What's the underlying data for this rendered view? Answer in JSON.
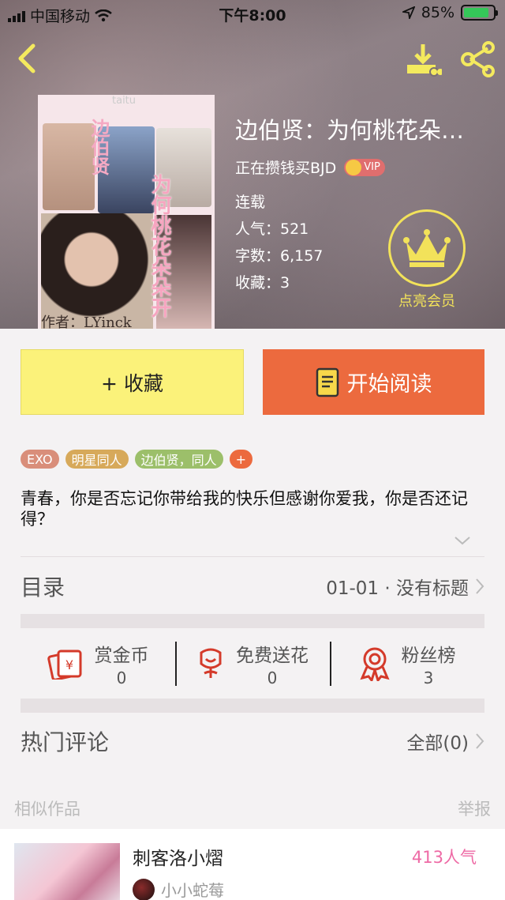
{
  "status_bar": {
    "carrier": "中国移动",
    "time": "下午8:00",
    "battery": "85%",
    "battery_level": 0.85
  },
  "book": {
    "title": "边伯贤：为何桃花朵…",
    "author": "正在攒钱买BJD",
    "vip_badge": "VIP",
    "status": "连载",
    "popularity": "人气：521",
    "word_count": "字数：6,157",
    "favorites": "收藏：3",
    "cover": {
      "top_text": "taitu",
      "title_vertical": "为何桃花朵朵开",
      "subtitle_vertical": "边伯贤",
      "author_line": "作者：LYinck"
    }
  },
  "member": {
    "label": "点亮会员"
  },
  "actions": {
    "favorite": "+ 收藏",
    "read": "开始阅读"
  },
  "tags": [
    {
      "label": "EXO",
      "color": "#d98e7a"
    },
    {
      "label": "明星同人",
      "color": "#d7a95a"
    },
    {
      "label": "边伯贤，同人",
      "color": "#9cbf6a"
    },
    {
      "label": "+",
      "color": "#ec6a3e"
    }
  ],
  "description": "青春，你是否忘记你带给我的快乐但感谢你爱我，你是否还记得？",
  "toc": {
    "label": "目录",
    "latest": "01-01 · 没有标题"
  },
  "stats": [
    {
      "label": "赏金币",
      "value": "0",
      "icon": "red-envelope-icon"
    },
    {
      "label": "免费送花",
      "value": "0",
      "icon": "flower-icon"
    },
    {
      "label": "粉丝榜",
      "value": "3",
      "icon": "medal-icon"
    }
  ],
  "comments": {
    "label": "热门评论",
    "all": "全部(0)"
  },
  "similar": {
    "header": "相似作品",
    "report": "举报",
    "items": [
      {
        "title": "刺客洛小熠",
        "popularity": "413人气",
        "author": "小小蛇莓"
      }
    ]
  },
  "colors": {
    "accent_yellow": "#fbf27a",
    "accent_orange": "#ec6a3e",
    "member_gold": "#f2e25a",
    "popularity_pink": "#ee6aa5"
  }
}
